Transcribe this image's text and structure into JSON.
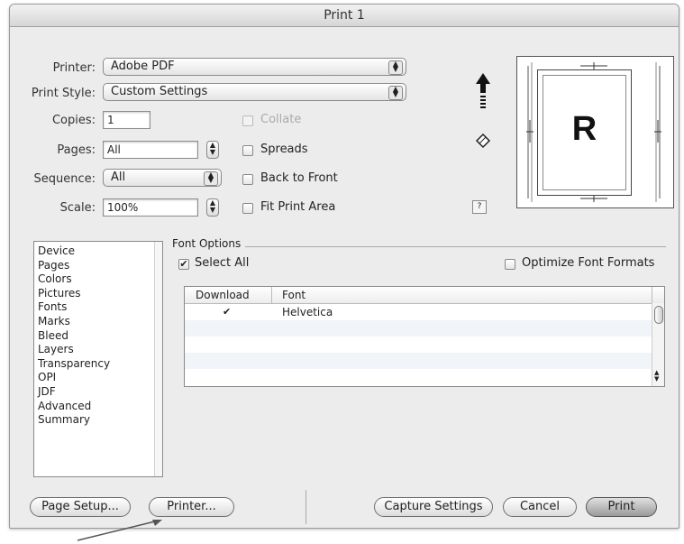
{
  "window": {
    "title": "Print 1"
  },
  "settings": {
    "printer_label": "Printer:",
    "printer_value": "Adobe PDF",
    "print_style_label": "Print Style:",
    "print_style_value": "Custom Settings",
    "copies_label": "Copies:",
    "copies_value": "1",
    "pages_label": "Pages:",
    "pages_value": "All",
    "sequence_label": "Sequence:",
    "sequence_value": "All",
    "scale_label": "Scale:",
    "scale_value": "100%"
  },
  "options": {
    "collate": {
      "label": "Collate",
      "checked": false,
      "enabled": false
    },
    "spreads": {
      "label": "Spreads",
      "checked": false
    },
    "back_to_front": {
      "label": "Back to Front",
      "checked": false
    },
    "fit_print_area": {
      "label": "Fit Print Area",
      "checked": false
    }
  },
  "preview": {
    "letter": "R",
    "help": "?"
  },
  "categories": [
    "Device",
    "Pages",
    "Colors",
    "Pictures",
    "Fonts",
    "Marks",
    "Bleed",
    "Layers",
    "Transparency",
    "OPI",
    "JDF",
    "Advanced",
    "Summary"
  ],
  "font_options": {
    "title": "Font Options",
    "select_all_label": "Select All",
    "select_all_checked": true,
    "optimize_label": "Optimize Font Formats",
    "optimize_checked": false,
    "columns": [
      "Download",
      "Font"
    ],
    "rows": [
      {
        "download": true,
        "font": "Helvetica"
      }
    ]
  },
  "buttons": {
    "page_setup": "Page Setup...",
    "printer": "Printer...",
    "capture_settings": "Capture Settings",
    "cancel": "Cancel",
    "print": "Print"
  },
  "icons": {
    "page_orientation": "up-arrow-icon",
    "paper_feed": "paper-feed-icon",
    "updown": "updown-arrows-icon",
    "checkmark": "checkmark-icon",
    "pointer": "annotation-arrow"
  },
  "colors": {
    "dialog_bg": "#ececec",
    "default_button": "#9a9a9a"
  }
}
